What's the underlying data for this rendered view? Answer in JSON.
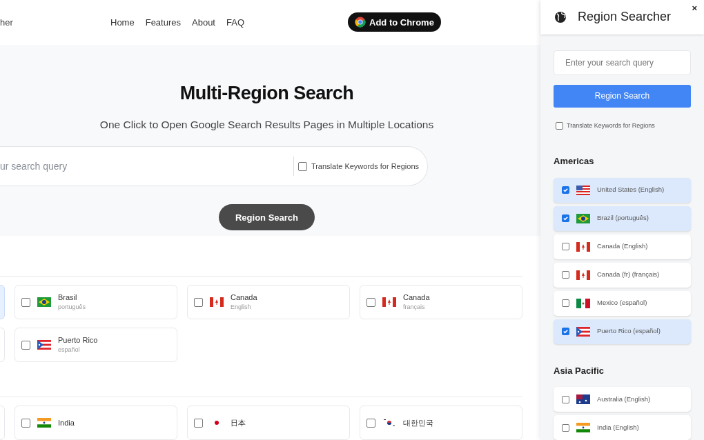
{
  "site": {
    "brand_fragment": "her",
    "nav": [
      "Home",
      "Features",
      "About",
      "FAQ"
    ],
    "cta": "Add to Chrome"
  },
  "hero": {
    "title": "Multi-Region Search",
    "subtitle": "One Click to Open Google Search Results Pages in Multiple Locations",
    "search_placeholder": "ur search query",
    "translate": {
      "label": "Translate Keywords for Regions",
      "checked": false
    },
    "button": "Region Search"
  },
  "region_groups": [
    {
      "edge_selected": true,
      "cards": [
        {
          "kind": "br",
          "name": "Brasil",
          "language": "português",
          "checked": false
        },
        {
          "kind": "ca",
          "name": "Canada",
          "language": "English",
          "checked": false
        },
        {
          "kind": "ca",
          "name": "Canada",
          "language": "français",
          "checked": false
        }
      ]
    },
    {
      "edge_selected": false,
      "cards": [
        {
          "kind": "pr",
          "name": "Puerto Rico",
          "language": "español",
          "checked": false
        }
      ]
    },
    {
      "edge_selected": false,
      "cards": [
        {
          "kind": "in",
          "name": "India",
          "checked": false
        },
        {
          "kind": "jp",
          "name": "日本",
          "checked": false
        },
        {
          "kind": "kr",
          "name": "대한민국",
          "checked": false
        }
      ]
    }
  ],
  "panel": {
    "title": "Region Searcher",
    "close": "×",
    "search_placeholder": "Enter your search query",
    "button": "Region Search",
    "translate": {
      "label": "Translate Keywords for Regions",
      "checked": false
    },
    "sections": [
      {
        "title": "Americas",
        "items": [
          {
            "kind": "us",
            "label": "United States (English)",
            "checked": true
          },
          {
            "kind": "br",
            "label": "Brazil (português)",
            "checked": true
          },
          {
            "kind": "ca",
            "label": "Canada (English)",
            "checked": false
          },
          {
            "kind": "ca",
            "label": "Canada (fr) (français)",
            "checked": false
          },
          {
            "kind": "mx",
            "label": "Mexico (español)",
            "checked": false
          },
          {
            "kind": "pr",
            "label": "Puerto Rico (español)",
            "checked": true
          }
        ]
      },
      {
        "title": "Asia Pacific",
        "items": [
          {
            "kind": "au",
            "label": "Australia (English)",
            "checked": false
          },
          {
            "kind": "in",
            "label": "India (English)",
            "checked": false
          }
        ]
      }
    ]
  }
}
